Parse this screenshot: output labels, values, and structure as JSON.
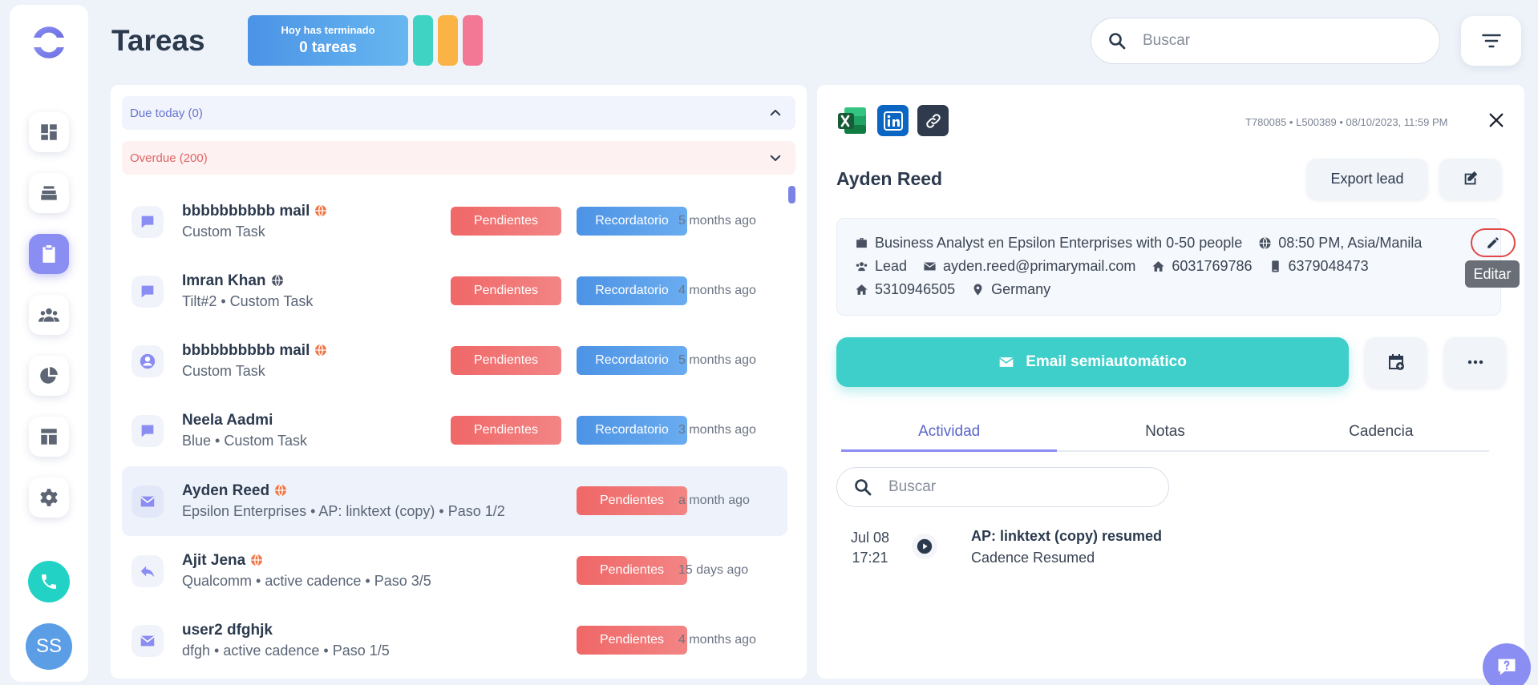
{
  "header": {
    "title": "Tareas",
    "summary_small": "Hoy has terminado",
    "summary_big": "0 tareas",
    "search_placeholder": "Buscar"
  },
  "colors": {
    "accent": "#8a8df2",
    "teal": "#3ecfca",
    "danger": "#f06767",
    "info": "#4d93e5"
  },
  "user": {
    "initials": "SS"
  },
  "groups": {
    "due": "Due today (0)",
    "overdue": "Overdue (200)"
  },
  "tasks": [
    {
      "title": "bbbbbbbbbb mail",
      "subtitle": "Custom Task",
      "status": "Pendientes",
      "tag": "Recordatorio",
      "time": "5 months ago",
      "icon": "chat-icon"
    },
    {
      "title": "Imran Khan",
      "subtitle": "Tilt#2 • Custom Task",
      "status": "Pendientes",
      "tag": "Recordatorio",
      "time": "4 months ago",
      "icon": "chat-icon"
    },
    {
      "title": "bbbbbbbbbb mail",
      "subtitle": "Custom Task",
      "status": "Pendientes",
      "tag": "Recordatorio",
      "time": "5 months ago",
      "icon": "user-icon"
    },
    {
      "title": "Neela Aadmi",
      "subtitle": "Blue • Custom Task",
      "status": "Pendientes",
      "tag": "Recordatorio",
      "time": "3 months ago",
      "icon": "chat-icon"
    },
    {
      "title": "Ayden Reed",
      "subtitle": "Epsilon Enterprises • AP: linktext (copy) • Paso 1/2",
      "status": "Pendientes",
      "time": "a month ago",
      "icon": "mail-icon"
    },
    {
      "title": "Ajit Jena",
      "subtitle": "Qualcomm • active cadence • Paso 3/5",
      "status": "Pendientes",
      "time": "15 days ago",
      "icon": "reply-icon"
    },
    {
      "title": "user2 dfghjk",
      "subtitle": "dfgh • active cadence • Paso 1/5",
      "status": "Pendientes",
      "time": "4 months ago",
      "icon": "mail-icon"
    }
  ],
  "detail": {
    "meta": "T780085 • L500389 • 08/10/2023, 11:59 PM",
    "name": "Ayden Reed",
    "export_label": "Export lead",
    "job": "Business Analyst en Epsilon Enterprises with 0-50 people",
    "timezone": "08:50 PM, Asia/Manila",
    "type": "Lead",
    "email": "ayden.reed@primarymail.com",
    "phone1": "6031769786",
    "mobile": "6379048473",
    "phone2": "5310946505",
    "country": "Germany",
    "edit_tooltip": "Editar",
    "email_button": "Email semiautomático",
    "tabs": [
      "Actividad",
      "Notas",
      "Cadencia"
    ],
    "activity_search_placeholder": "Buscar",
    "activity": {
      "date": "Jul 08",
      "time": "17:21",
      "title": "AP: linktext (copy) resumed",
      "subtitle": "Cadence Resumed"
    }
  }
}
